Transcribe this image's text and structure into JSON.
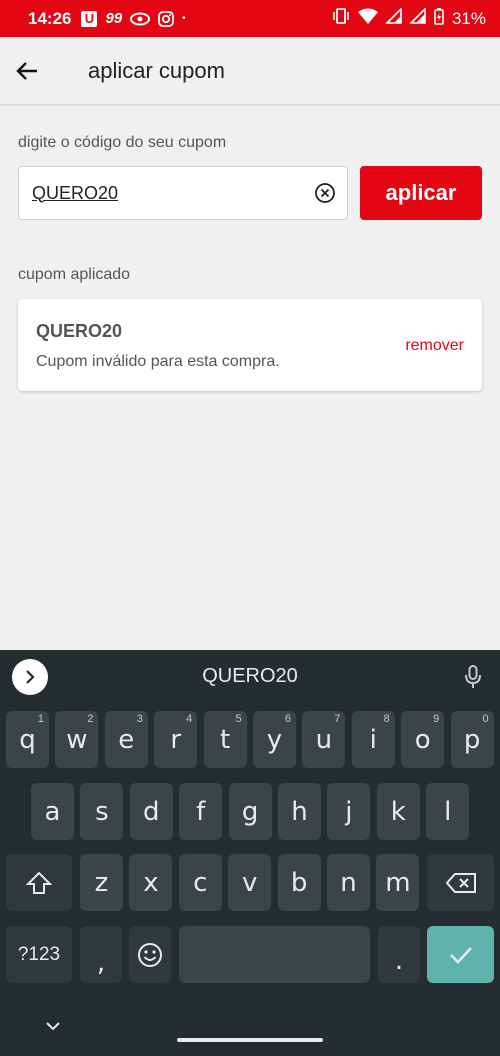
{
  "status_bar": {
    "time": "14:26",
    "app_icon_u": "U",
    "app_icon_99": "99",
    "dot": "•",
    "battery": "31%"
  },
  "app_bar": {
    "title": "aplicar cupom"
  },
  "coupon_form": {
    "label": "digite o código do seu cupom",
    "input_value": "QUERO20",
    "apply_label": "aplicar"
  },
  "applied": {
    "label": "cupom aplicado",
    "code": "QUERO20",
    "message": "Cupom inválido para esta compra.",
    "remove_label": "remover"
  },
  "keyboard": {
    "suggestion": "QUERO20",
    "row1": [
      {
        "key": "q",
        "hint": "1"
      },
      {
        "key": "w",
        "hint": "2"
      },
      {
        "key": "e",
        "hint": "3"
      },
      {
        "key": "r",
        "hint": "4"
      },
      {
        "key": "t",
        "hint": "5"
      },
      {
        "key": "y",
        "hint": "6"
      },
      {
        "key": "u",
        "hint": "7"
      },
      {
        "key": "i",
        "hint": "8"
      },
      {
        "key": "o",
        "hint": "9"
      },
      {
        "key": "p",
        "hint": "0"
      }
    ],
    "row2": [
      "a",
      "s",
      "d",
      "f",
      "g",
      "h",
      "j",
      "k",
      "l"
    ],
    "row3": [
      "z",
      "x",
      "c",
      "v",
      "b",
      "n",
      "m"
    ],
    "symbols_label": "?123",
    "comma": ",",
    "period": "."
  },
  "colors": {
    "brand_red": "#e30613",
    "keyboard_bg": "#262d31",
    "key_bg": "#3c4448",
    "enter_key": "#5fb3ad"
  }
}
